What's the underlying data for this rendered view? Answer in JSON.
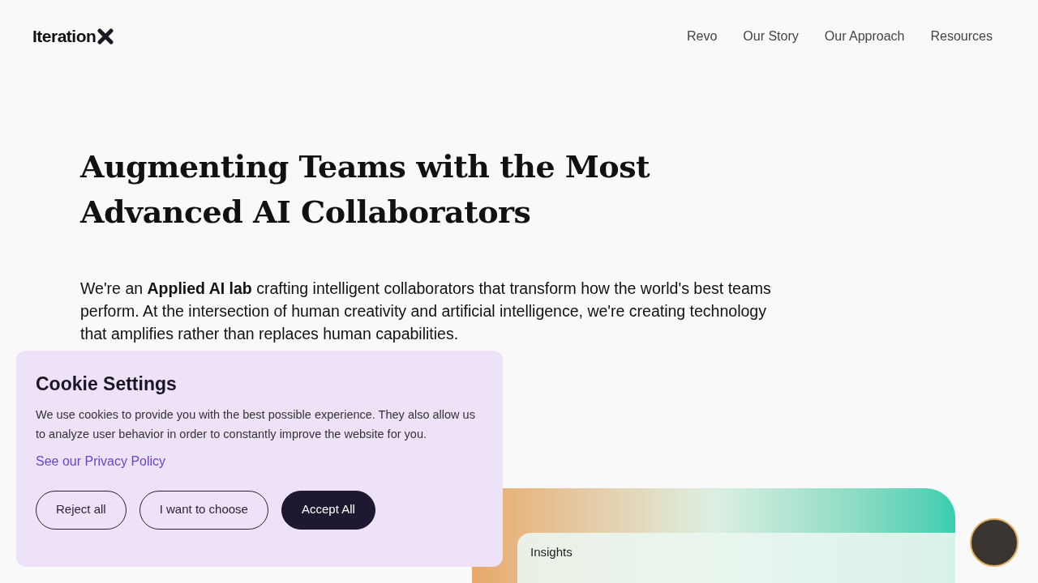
{
  "header": {
    "logo": "Iteration",
    "nav": [
      {
        "label": "Revo"
      },
      {
        "label": "Our Story"
      },
      {
        "label": "Our Approach"
      },
      {
        "label": "Resources"
      }
    ]
  },
  "hero": {
    "title_lines": [
      "Augmenting Teams with the Most",
      "Advanced AI Collaborators"
    ],
    "intro": "We're an **Applied AI lab** crafting intelligent collaborators that transform how the world's best teams perform. At the intersection of human creativity and artificial intelligence, we're creating technology that amplifies rather than replaces human capabilities."
  },
  "preview_card": {
    "panel_title": "Insights"
  },
  "cookie_banner": {
    "title": "Cookie Settings",
    "text": "We use cookies to provide you with the best possible experience. They also allow us to analyze user behavior in order to constantly improve the website for you.",
    "link": "See our Privacy Policy",
    "buttons": [
      {
        "label": "Reject all",
        "kind": "outline"
      },
      {
        "label": "I want to choose",
        "kind": "outline"
      },
      {
        "label": "Accept All",
        "kind": "primary"
      }
    ]
  }
}
